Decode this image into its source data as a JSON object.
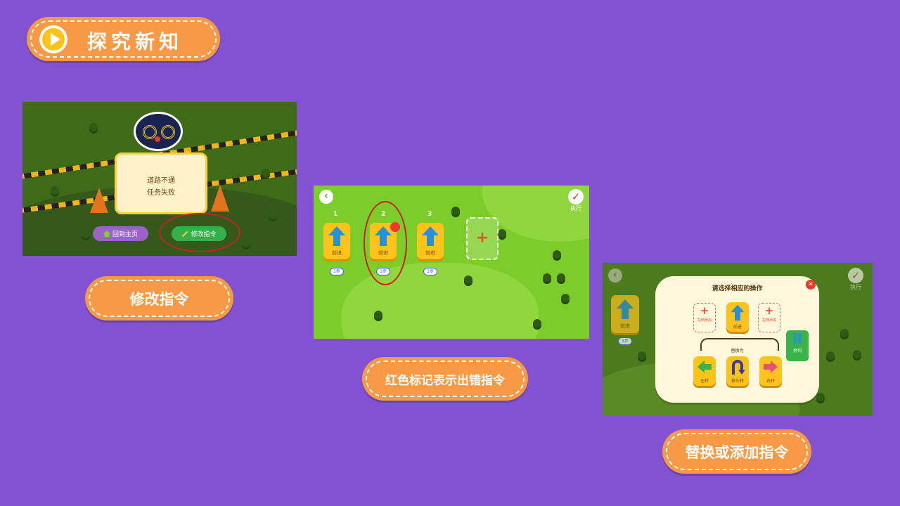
{
  "header": {
    "title": "探究新知"
  },
  "captions": {
    "modify": "修改指令",
    "red_mark": "红色标记表示出错指令",
    "replace": "替换或添加指令"
  },
  "screen1": {
    "dialog_line1": "道路不通",
    "dialog_line2": "任务失败",
    "home_button": "回到主页",
    "modify_button": "修改指令"
  },
  "screen2": {
    "execute_label": "执行",
    "slots": [
      {
        "number": "1",
        "label": "前进",
        "steps": "1步"
      },
      {
        "number": "2",
        "label": "前进",
        "steps": "1步"
      },
      {
        "number": "3",
        "label": "前进",
        "steps": "1步"
      }
    ]
  },
  "screen3": {
    "execute_label": "执行",
    "panel_title": "请选择相应的操作",
    "add_before": "左侧添加",
    "current": "前进",
    "add_after": "右侧添加",
    "replace_label": "替换为",
    "options": [
      "左转",
      "掉头转",
      "右转"
    ],
    "parallel": "并列",
    "bg_label": "前进",
    "bg_steps": "1步"
  },
  "colors": {
    "background": "#8352d2",
    "pill": "#f89a45",
    "grass": "#7ccd2a",
    "card": "#ffc31b",
    "arrow_blue": "#2a8fd6",
    "error_red": "#e8392b"
  }
}
